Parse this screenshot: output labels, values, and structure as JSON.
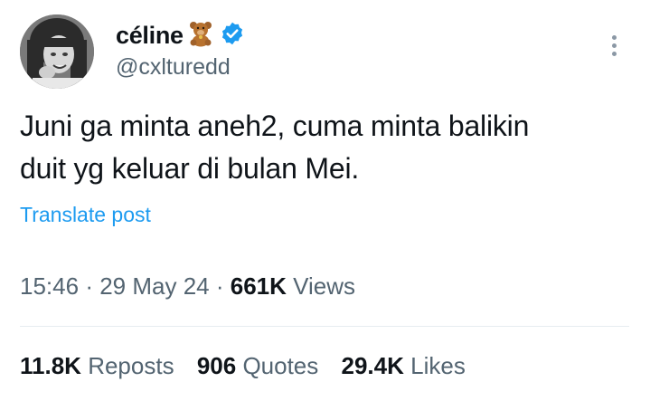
{
  "author": {
    "display_name": "céline",
    "handle": "@cxlturedd",
    "name_emoji": "teddy-bear-icon",
    "verified": true
  },
  "tweet": {
    "text_line1": "Juni ga minta aneh2, cuma minta balikin",
    "text_line2": "duit yg keluar di bulan Mei.",
    "translate_label": "Translate post"
  },
  "meta": {
    "time": "15:46",
    "separator": "·",
    "date": "29 May 24",
    "views_count": "661K",
    "views_label": "Views"
  },
  "stats": {
    "reposts_count": "11.8K",
    "reposts_label": "Reposts",
    "quotes_count": "906",
    "quotes_label": "Quotes",
    "likes_count": "29.4K",
    "likes_label": "Likes"
  },
  "colors": {
    "text": "#0f1419",
    "secondary": "#536471",
    "link": "#1d9bf0",
    "verified": "#1d9bf0",
    "divider": "#e6ecf0"
  }
}
